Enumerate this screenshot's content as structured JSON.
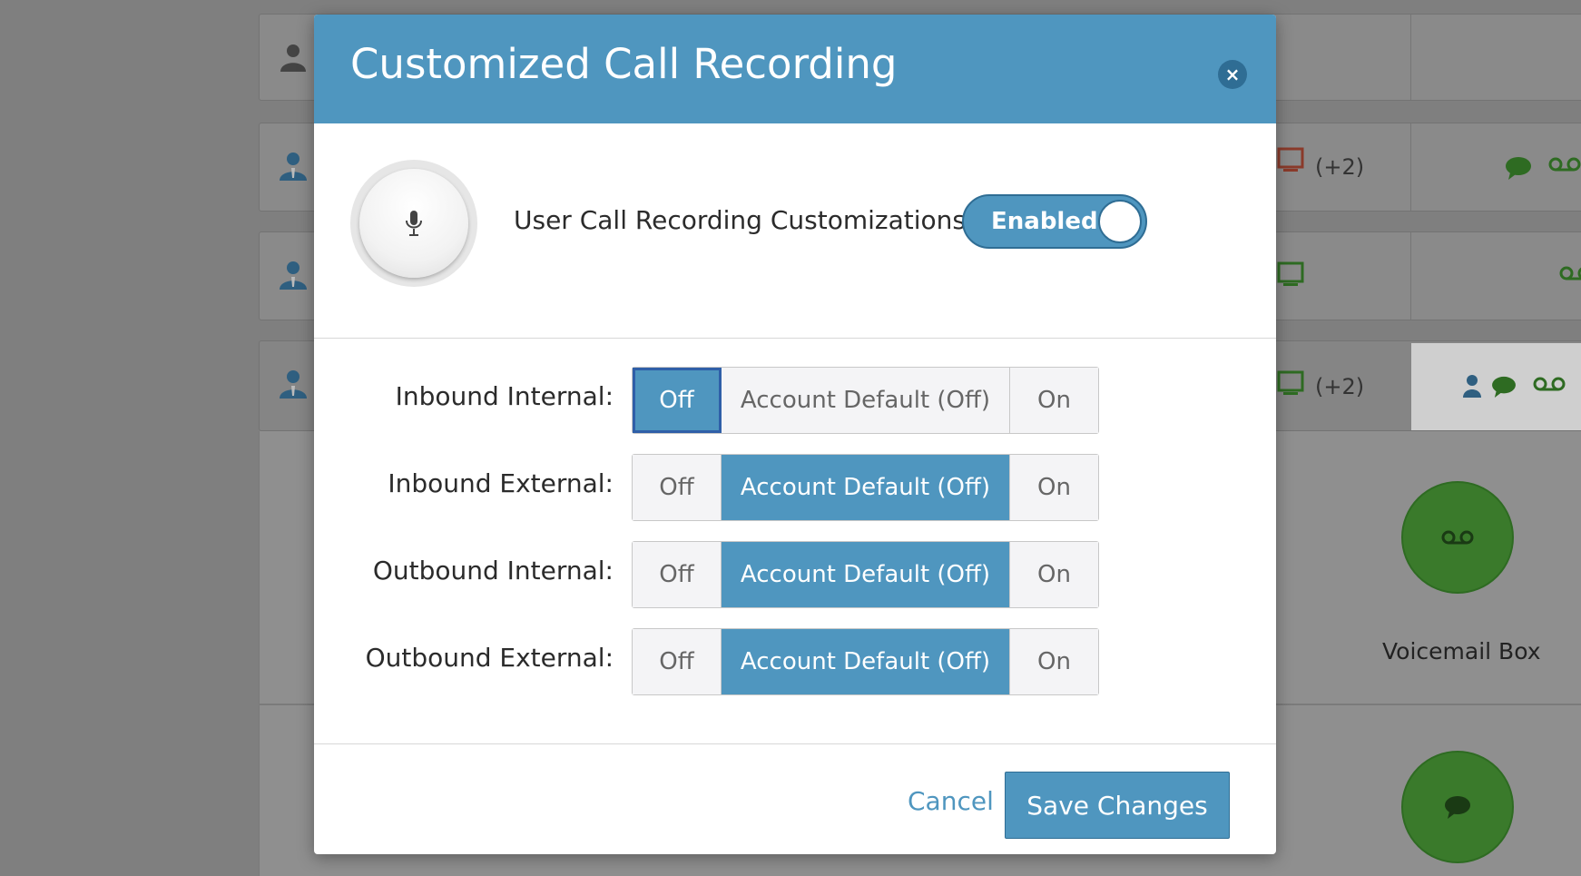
{
  "modal": {
    "title": "Customized Call Recording",
    "close_label": "×",
    "recording_label": "User Call Recording Customizations",
    "toggle_label": "Enabled",
    "rows": [
      {
        "label": "Inbound Internal:",
        "options": [
          "Off",
          "Account Default (Off)",
          "On"
        ],
        "selected": "Off"
      },
      {
        "label": "Inbound External:",
        "options": [
          "Off",
          "Account Default (Off)",
          "On"
        ],
        "selected": "Account Default (Off)"
      },
      {
        "label": "Outbound Internal:",
        "options": [
          "Off",
          "Account Default (Off)",
          "On"
        ],
        "selected": "Account Default (Off)"
      },
      {
        "label": "Outbound External:",
        "options": [
          "Off",
          "Account Default (Off)",
          "On"
        ],
        "selected": "Account Default (Off)"
      }
    ],
    "cancel_label": "Cancel",
    "save_label": "Save Changes"
  },
  "background": {
    "badge_1": "(+2)",
    "badge_2": "(+2)",
    "voicemail_label": "Voicemail Box"
  },
  "colors": {
    "primary": "#4f96bf",
    "primary_dark": "#2f6d94",
    "overlay": "#7f7f7f"
  }
}
